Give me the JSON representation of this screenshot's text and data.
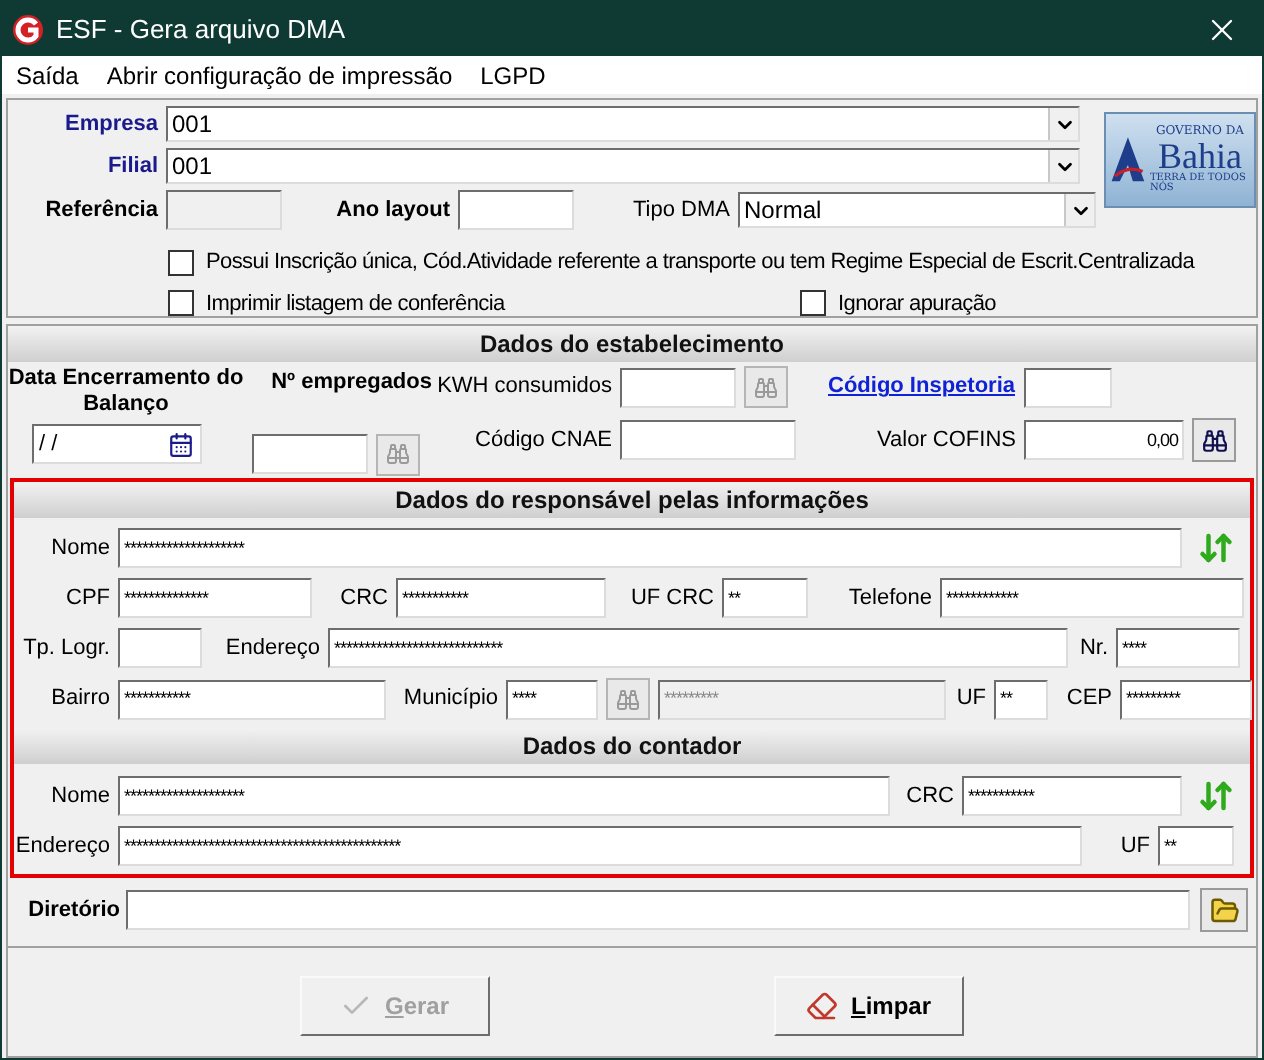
{
  "window": {
    "title": "ESF - Gera arquivo DMA"
  },
  "menu": [
    {
      "label": "Saída"
    },
    {
      "label": "Abrir configuração de impressão"
    },
    {
      "label": "LGPD"
    }
  ],
  "header": {
    "empresa": {
      "label": "Empresa",
      "value": "001"
    },
    "filial": {
      "label": "Filial",
      "value": "001"
    },
    "referencia": {
      "label": "Referência",
      "disabled": true
    },
    "ano_layout": {
      "label": "Ano layout"
    },
    "tipo_dma": {
      "label": "Tipo DMA",
      "value": "Normal"
    },
    "logo": {
      "top": "GOVERNO DA",
      "name": "Bahia",
      "tagline": "TERRA DE TODOS NÓS"
    }
  },
  "options": [
    {
      "label": "Possui Inscrição única, Cód.Atividade referente a transporte ou tem Regime Especial de Escrit.Centralizada",
      "checked": false
    },
    {
      "label": "Imprimir listagem de conferência",
      "checked": false
    },
    {
      "label": "Ignorar apuração",
      "checked": false
    }
  ],
  "estabelecimento": {
    "title": "Dados do estabelecimento",
    "data_label": "Data Encerramento do Balanço",
    "data_value": "/ /",
    "empregados_label": "Nº empregados",
    "kwh_label": "KWH consumidos",
    "inspetoria_link": "Código Inspetoria",
    "cnae_label": "Código CNAE",
    "cofins_label": "Valor COFINS",
    "cofins_value": "0,00"
  },
  "responsavel": {
    "title": "Dados do responsável pelas informações",
    "nome": {
      "label": "Nome",
      "value": "********************"
    },
    "cpf": {
      "label": "CPF",
      "value": "**************"
    },
    "crc": {
      "label": "CRC",
      "value": "***********"
    },
    "uf_crc": {
      "label": "UF CRC",
      "value": "**"
    },
    "telefone": {
      "label": "Telefone",
      "value": "************"
    },
    "tp_logr": {
      "label": "Tp. Logr."
    },
    "endereco": {
      "label": "Endereço",
      "value": "****************************"
    },
    "nr": {
      "label": "Nr.",
      "value": "****"
    },
    "bairro": {
      "label": "Bairro",
      "value": "***********"
    },
    "municipio": {
      "label": "Município",
      "value": "****",
      "name_value": "*********",
      "name_disabled": true
    },
    "uf": {
      "label": "UF",
      "value": "**"
    },
    "cep": {
      "label": "CEP",
      "value": "*********"
    }
  },
  "contador": {
    "title": "Dados do contador",
    "nome": {
      "label": "Nome",
      "value": "********************"
    },
    "crc": {
      "label": "CRC",
      "value": "***********"
    },
    "endereco": {
      "label": "Endereço",
      "value": "**********************************************"
    },
    "uf": {
      "label": "UF",
      "value": "**"
    }
  },
  "diretorio": {
    "label": "Diretório"
  },
  "buttons": [
    {
      "label": "Gerar",
      "kind": "check",
      "disabled": true
    },
    {
      "label": "Limpar",
      "kind": "eraser",
      "disabled": false
    }
  ]
}
